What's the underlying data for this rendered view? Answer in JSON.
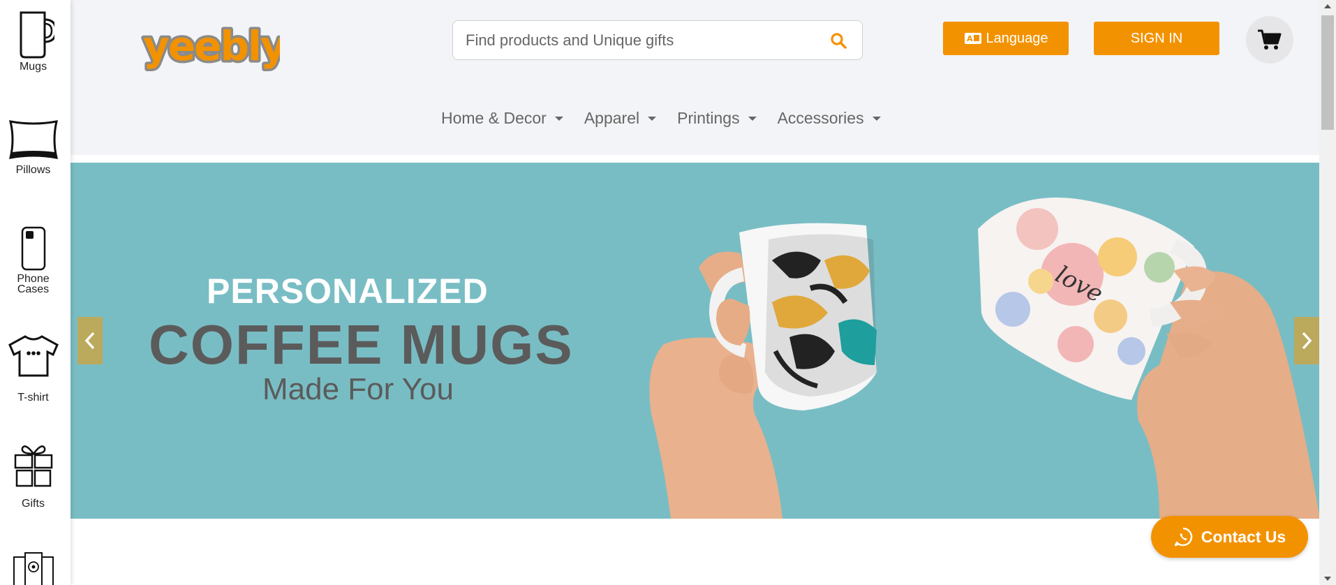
{
  "sidebar": {
    "items": [
      {
        "label": "Mugs",
        "icon": "mug-icon"
      },
      {
        "label": "Pillows",
        "icon": "pillow-icon"
      },
      {
        "label": "Phone Cases",
        "icon": "phone-case-icon"
      },
      {
        "label": "T-shirt",
        "icon": "tshirt-icon"
      },
      {
        "label": "Gifts",
        "icon": "gift-icon"
      },
      {
        "label": "",
        "icon": "frames-icon"
      }
    ]
  },
  "header": {
    "logo_text": "yeebly",
    "search_placeholder": "Find products and Unique gifts",
    "language_label": "Language",
    "signin_label": "SIGN IN"
  },
  "nav": {
    "items": [
      "Home & Decor",
      "Apparel",
      "Printings",
      "Accessories"
    ]
  },
  "hero": {
    "line1": "PERSONALIZED",
    "line2": "COFFEE MUGS",
    "line3": "Made For You",
    "mug_text": "love"
  },
  "contact_label": "Contact Us",
  "colors": {
    "brand_orange": "#f39200",
    "hero_bg": "#79bdc4",
    "header_bg": "#f3f4f7"
  }
}
